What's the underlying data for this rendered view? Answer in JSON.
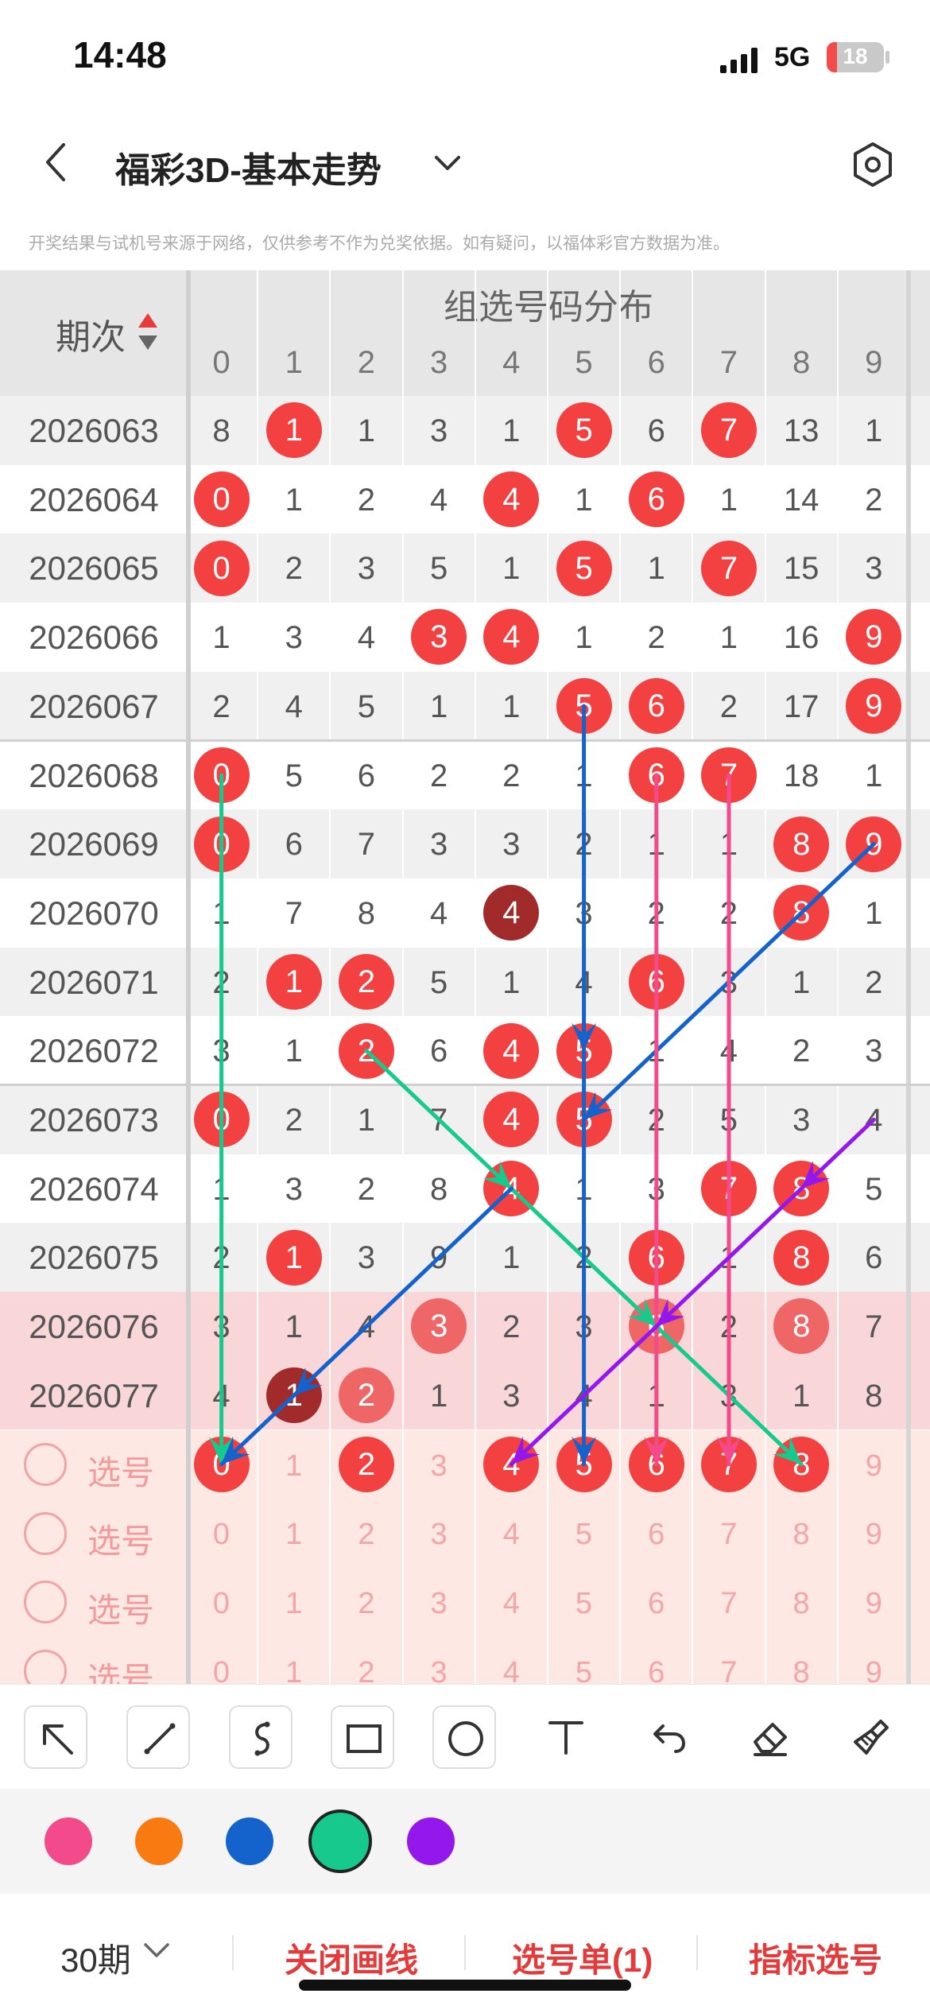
{
  "status_bar": {
    "time": "14:48",
    "network": "5G",
    "battery": "18",
    "battery_level": 0.18
  },
  "nav": {
    "title": "福彩3D-基本走势"
  },
  "disclaimer": "开奖结果与试机号来源于网络，仅供参考不作为兑奖依据。如有疑问，以福体彩官方数据为准。",
  "table": {
    "period_header": "期次",
    "group_header": "组选号码分布",
    "digits": [
      "0",
      "1",
      "2",
      "3",
      "4",
      "5",
      "6",
      "7",
      "8",
      "9"
    ],
    "rows": [
      {
        "period": "2026063",
        "cells": [
          "8",
          1,
          "1",
          "3",
          "1",
          5,
          "6",
          7,
          "13",
          "1"
        ]
      },
      {
        "period": "2026064",
        "cells": [
          0,
          "1",
          "2",
          "4",
          4,
          "1",
          6,
          "1",
          "14",
          "2"
        ]
      },
      {
        "period": "2026065",
        "cells": [
          0,
          "2",
          "3",
          "5",
          "1",
          5,
          "1",
          7,
          "15",
          "3"
        ]
      },
      {
        "period": "2026066",
        "cells": [
          "1",
          "3",
          "4",
          3,
          4,
          "1",
          "2",
          "1",
          "16",
          9
        ]
      },
      {
        "period": "2026067",
        "cells": [
          "2",
          "4",
          "5",
          "1",
          "1",
          5,
          6,
          "2",
          "17",
          9
        ]
      },
      {
        "period": "2026068",
        "cells": [
          0,
          "5",
          "6",
          "2",
          "2",
          "1",
          6,
          7,
          "18",
          "1"
        ]
      },
      {
        "period": "2026069",
        "cells": [
          0,
          "6",
          "7",
          "3",
          "3",
          "2",
          "1",
          "1",
          8,
          9
        ]
      },
      {
        "period": "2026070",
        "cells": [
          "1",
          "7",
          "8",
          "4",
          4,
          "3",
          "2",
          "2",
          8,
          "1"
        ]
      },
      {
        "period": "2026071",
        "cells": [
          "2",
          1,
          2,
          "5",
          "1",
          "4",
          6,
          "3",
          "1",
          "2"
        ]
      },
      {
        "period": "2026072",
        "cells": [
          "3",
          "1",
          2,
          "6",
          4,
          5,
          "1",
          "4",
          "2",
          "3"
        ]
      },
      {
        "period": "2026073",
        "cells": [
          0,
          "2",
          "1",
          "7",
          4,
          5,
          "2",
          "5",
          "3",
          "4"
        ]
      },
      {
        "period": "2026074",
        "cells": [
          "1",
          "3",
          "2",
          "8",
          4,
          "1",
          "3",
          7,
          8,
          "5"
        ]
      },
      {
        "period": "2026075",
        "cells": [
          "2",
          1,
          "3",
          "9",
          "1",
          "2",
          6,
          "1",
          8,
          "6"
        ]
      },
      {
        "period": "2026076",
        "cells": [
          "3",
          "1",
          "4",
          3,
          "2",
          "3",
          6,
          "2",
          8,
          "7"
        ]
      },
      {
        "period": "2026077",
        "cells": [
          "4",
          1,
          2,
          "1",
          "3",
          "4",
          "1",
          "3",
          "1",
          "8"
        ]
      }
    ],
    "pick_rows": [
      {
        "label": "选号",
        "selected": [
          0,
          2,
          4,
          5,
          6,
          7,
          8
        ]
      },
      {
        "label": "选号",
        "selected": []
      },
      {
        "label": "选号",
        "selected": []
      },
      {
        "label": "选号",
        "selected": []
      }
    ]
  },
  "toolbar": {
    "tools": [
      "arrow-tool",
      "line-tool",
      "curve-tool",
      "rectangle-tool",
      "circle-tool",
      "text-tool",
      "undo-tool",
      "eraser-tool",
      "clear-tool"
    ]
  },
  "colors": {
    "palette": [
      "#f34a8c",
      "#f97a10",
      "#1462cc",
      "#17c98c",
      "#9418ec"
    ],
    "selected": "#17c98c",
    "ball_red": "#f34040",
    "highlight_rows": "#f9d6d8",
    "pick_area": "#fde8e3"
  },
  "bottom_bar": {
    "period_select": "30期",
    "close_lines": "关闭画线",
    "pick_list": "选号单(1)",
    "indicator_pick": "指标选号"
  }
}
